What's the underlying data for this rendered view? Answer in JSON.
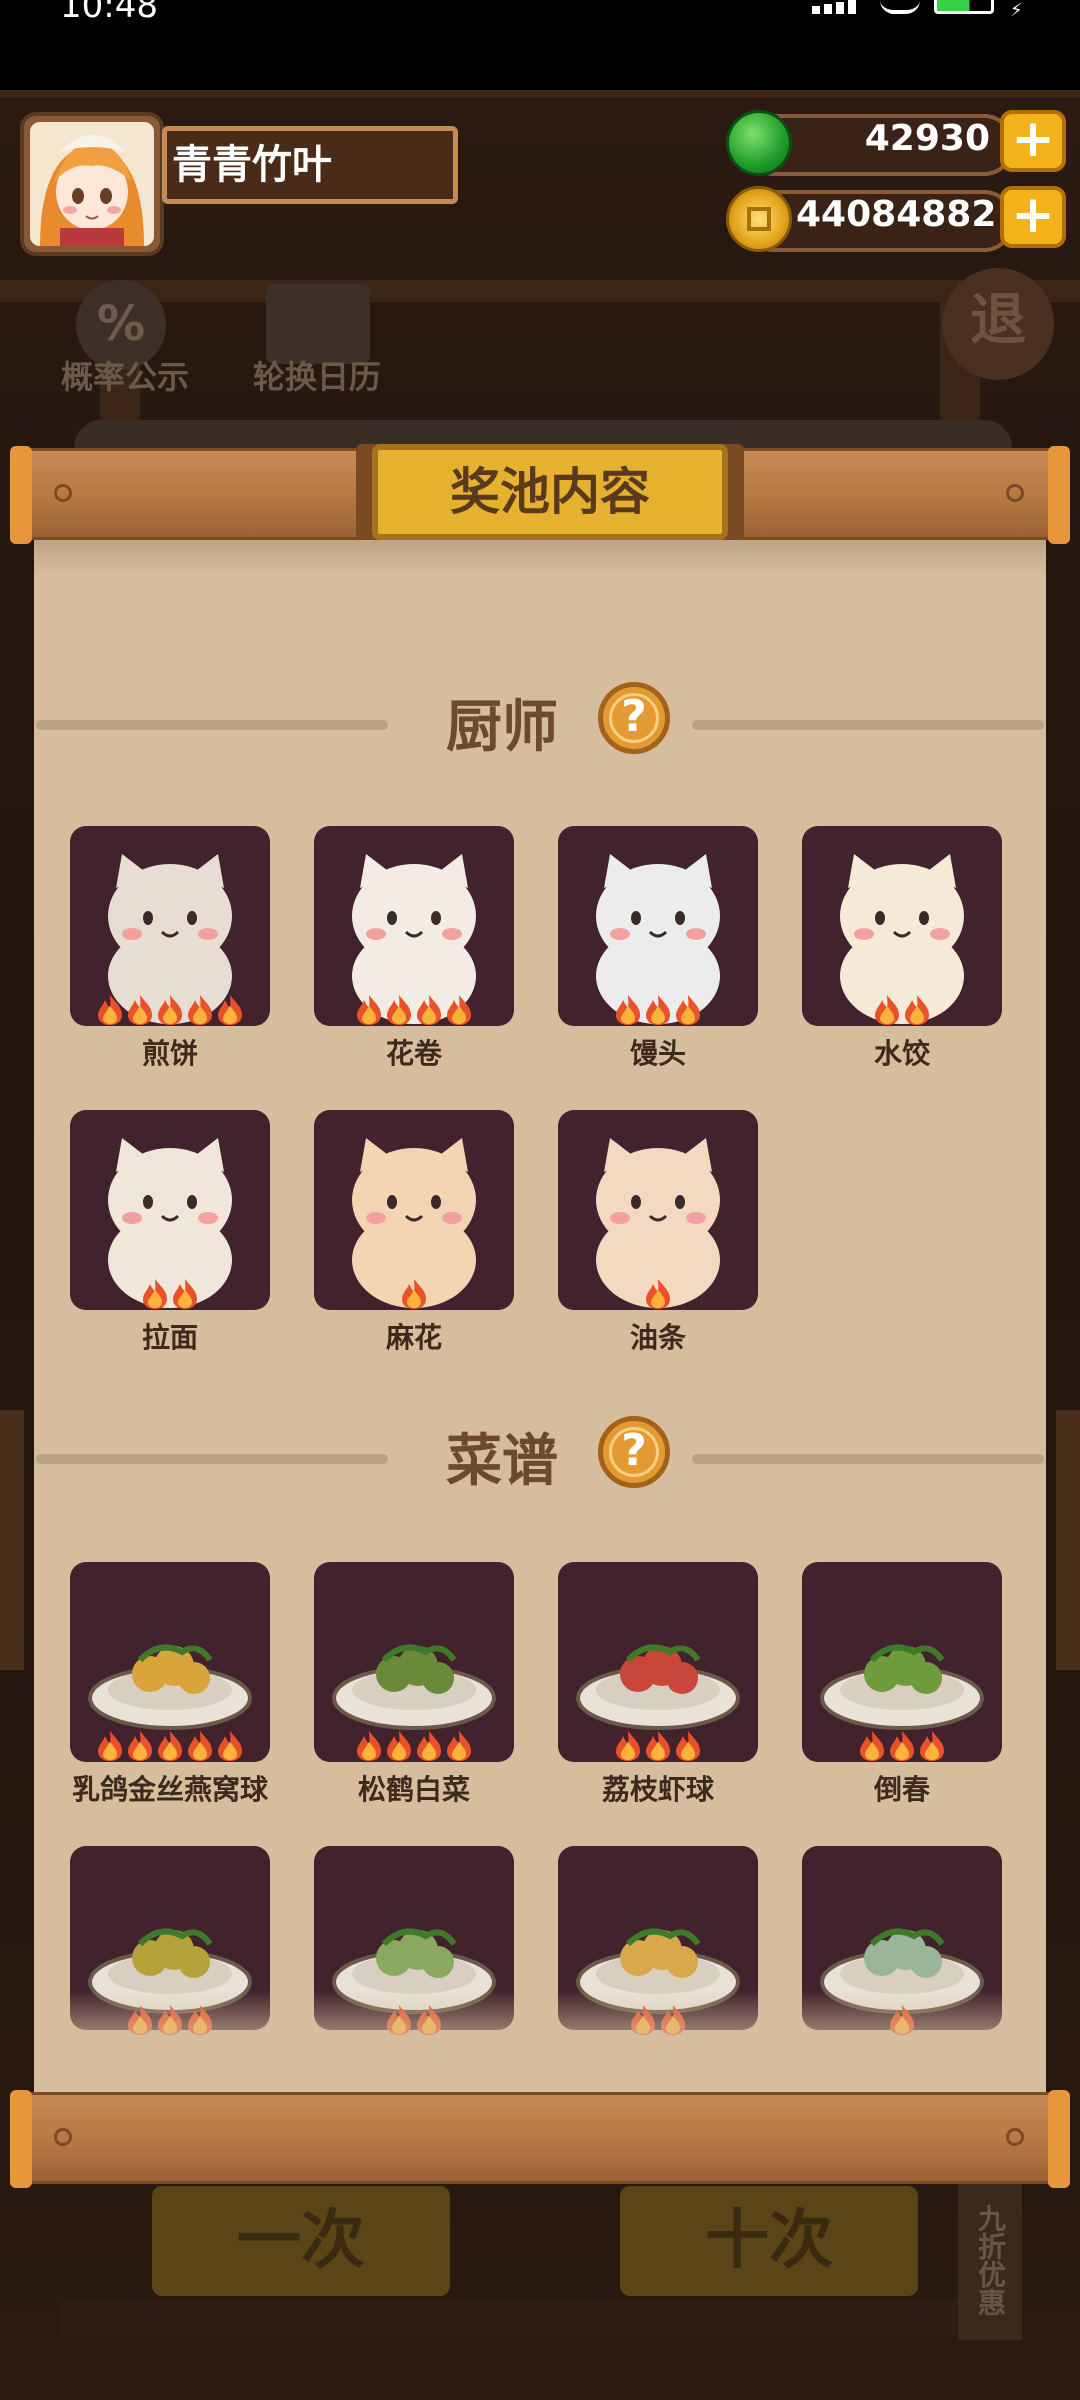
{
  "status_bar": {
    "time": "10:48"
  },
  "header": {
    "player_name": "青青竹叶",
    "jade": {
      "icon": "jade-coin-icon",
      "value": "42930"
    },
    "gold": {
      "icon": "gold-coin-icon",
      "value": "44084882"
    }
  },
  "background": {
    "probability_label": "概率公示",
    "calendar_label": "轮换日历",
    "exit_label": "退",
    "single_draw_label": "一次",
    "ten_draw_label": "十次",
    "discount_label": "九折优惠"
  },
  "panel": {
    "title": "奖池内容",
    "chef_section": {
      "title": "厨师",
      "items": [
        {
          "name": "煎饼",
          "rating": 5,
          "color": "#e8ddd2"
        },
        {
          "name": "花卷",
          "rating": 4,
          "color": "#f3ece4"
        },
        {
          "name": "馒头",
          "rating": 3,
          "color": "#ececec"
        },
        {
          "name": "水饺",
          "rating": 2,
          "color": "#f5e9d8"
        },
        {
          "name": "拉面",
          "rating": 2,
          "color": "#f1e6da"
        },
        {
          "name": "麻花",
          "rating": 1,
          "color": "#f3d4b3"
        },
        {
          "name": "油条",
          "rating": 1,
          "color": "#f2d9bf"
        }
      ]
    },
    "recipe_section": {
      "title": "菜谱",
      "items": [
        {
          "name": "乳鸽金丝燕窝球",
          "rating": 5,
          "color": "#d9a43a"
        },
        {
          "name": "松鹤白菜",
          "rating": 4,
          "color": "#6a8a3a"
        },
        {
          "name": "荔枝虾球",
          "rating": 3,
          "color": "#c8463a"
        },
        {
          "name": "倒春",
          "rating": 3,
          "color": "#6f9a3d"
        },
        {
          "name": "",
          "rating": 3,
          "color": "#b5a23a"
        },
        {
          "name": "",
          "rating": 2,
          "color": "#8aa860"
        },
        {
          "name": "",
          "rating": 2,
          "color": "#d8a84a"
        },
        {
          "name": "",
          "rating": 1,
          "color": "#9ab59a"
        }
      ]
    }
  }
}
